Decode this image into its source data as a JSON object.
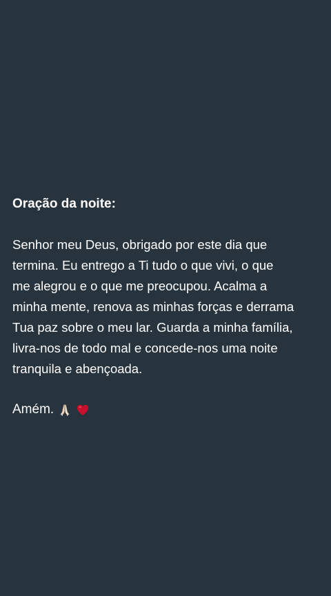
{
  "post": {
    "title": "Oração da noite:",
    "lines": [
      "Senhor meu Deus, obrigado por este dia que",
      "termina. Eu entrego a Ti tudo o que vivi, o que",
      "me alegrou e o que me preocupou. Acalma a",
      "minha mente, renova as minhas forças e derrama",
      "Tua paz sobre o meu lar. Guarda a minha família,",
      "livra-nos de todo mal e concede-nos uma noite",
      "tranquila e abençoada."
    ],
    "closing": "Amém.",
    "closing_icons": [
      "praying-hands-icon",
      "red-heart-icon"
    ]
  },
  "colors": {
    "background": "#27333d",
    "text": "#ffffff",
    "heart": "#c8102e"
  }
}
